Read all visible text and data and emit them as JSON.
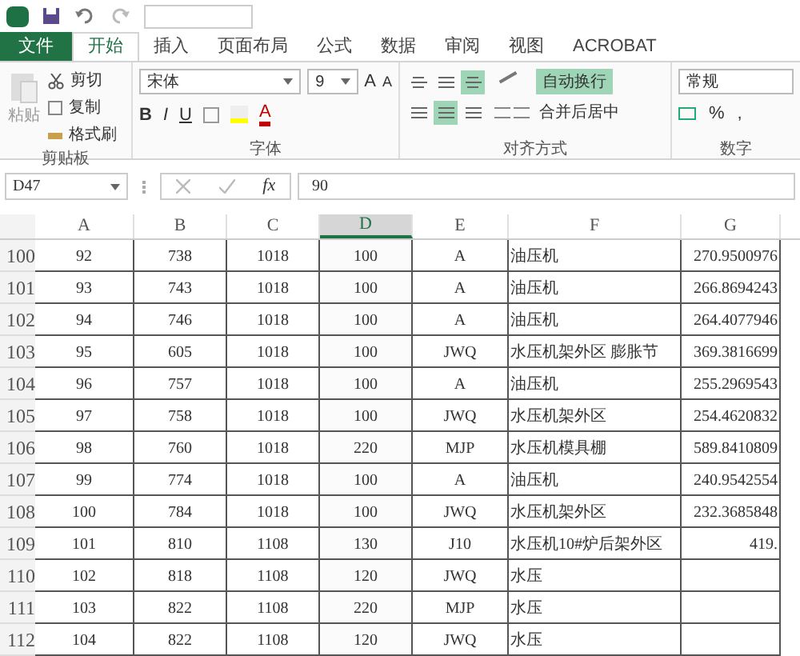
{
  "tabs": [
    {
      "label": "文件",
      "kind": "file",
      "selected": false
    },
    {
      "label": "开始",
      "kind": "tab",
      "selected": true
    },
    {
      "label": "插入",
      "kind": "tab",
      "selected": false
    },
    {
      "label": "页面布局",
      "kind": "tab",
      "selected": false
    },
    {
      "label": "公式",
      "kind": "tab",
      "selected": false
    },
    {
      "label": "数据",
      "kind": "tab",
      "selected": false
    },
    {
      "label": "审阅",
      "kind": "tab",
      "selected": false
    },
    {
      "label": "视图",
      "kind": "tab",
      "selected": false
    },
    {
      "label": "ACROBAT",
      "kind": "tab",
      "selected": false
    }
  ],
  "clipboard": {
    "paste": "粘贴",
    "cut": "剪切",
    "copy": "复制",
    "format_painter": "格式刷",
    "label": "剪贴板"
  },
  "font": {
    "name": "宋体",
    "size": "9",
    "grow": "A",
    "shrink": "A",
    "bold": "B",
    "italic": "I",
    "underline": "U",
    "font_color": "A",
    "label": "字体"
  },
  "alignment": {
    "wrap_text": {
      "label": "自动换行",
      "on": true
    },
    "merge": "合并后居中",
    "label": "对齐方式",
    "align_top": [
      {
        "selected": false
      },
      {
        "selected": false
      },
      {
        "selected": true
      }
    ],
    "align_h": [
      {
        "selected": false
      },
      {
        "selected": true
      },
      {
        "selected": false
      }
    ]
  },
  "number": {
    "format": "常规",
    "percent": "%",
    "comma": ",",
    "label": "数字"
  },
  "formula_bar": {
    "name_box": "D47",
    "fx": "fx",
    "value": "90"
  },
  "columns": [
    {
      "label": "A",
      "selected": false
    },
    {
      "label": "B",
      "selected": false
    },
    {
      "label": "C",
      "selected": false
    },
    {
      "label": "D",
      "selected": true
    },
    {
      "label": "E",
      "selected": false
    },
    {
      "label": "F",
      "selected": false
    },
    {
      "label": "G",
      "selected": false
    }
  ],
  "rows": [
    {
      "header": "100",
      "cells": [
        "92",
        "738",
        "1018",
        "100",
        "A",
        "油压机",
        "270.9500976"
      ]
    },
    {
      "header": "101",
      "cells": [
        "93",
        "743",
        "1018",
        "100",
        "A",
        "油压机",
        "266.8694243"
      ]
    },
    {
      "header": "102",
      "cells": [
        "94",
        "746",
        "1018",
        "100",
        "A",
        "油压机",
        "264.4077946"
      ]
    },
    {
      "header": "103",
      "cells": [
        "95",
        "605",
        "1018",
        "100",
        "JWQ",
        "水压机架外区 膨胀节",
        "369.3816699"
      ]
    },
    {
      "header": "104",
      "cells": [
        "96",
        "757",
        "1018",
        "100",
        "A",
        "油压机",
        "255.2969543"
      ]
    },
    {
      "header": "105",
      "cells": [
        "97",
        "758",
        "1018",
        "100",
        "JWQ",
        "水压机架外区",
        "254.4620832"
      ]
    },
    {
      "header": "106",
      "cells": [
        "98",
        "760",
        "1018",
        "220",
        "MJP",
        "水压机模具棚",
        "589.8410809"
      ]
    },
    {
      "header": "107",
      "cells": [
        "99",
        "774",
        "1018",
        "100",
        "A",
        "油压机",
        "240.9542554"
      ]
    },
    {
      "header": "108",
      "cells": [
        "100",
        "784",
        "1018",
        "100",
        "JWQ",
        "水压机架外区",
        "232.3685848"
      ]
    },
    {
      "header": "109",
      "cells": [
        "101",
        "810",
        "1108",
        "130",
        "J10",
        "水压机10#炉后架外区",
        "419."
      ]
    },
    {
      "header": "110",
      "cells": [
        "102",
        "818",
        "1108",
        "120",
        "JWQ",
        "水压",
        ""
      ]
    },
    {
      "header": "111",
      "cells": [
        "103",
        "822",
        "1108",
        "220",
        "MJP",
        "水压",
        ""
      ]
    },
    {
      "header": "112",
      "cells": [
        "104",
        "822",
        "1108",
        "120",
        "JWQ",
        "水压",
        ""
      ]
    }
  ]
}
